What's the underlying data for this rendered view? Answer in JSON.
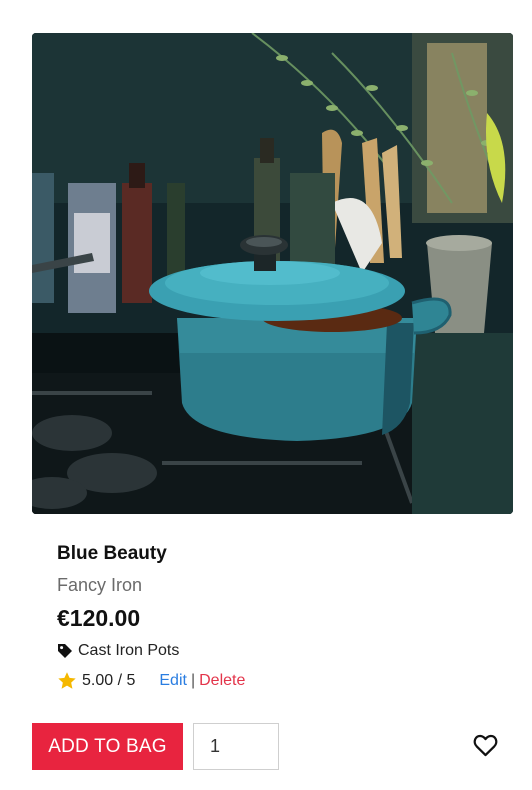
{
  "product": {
    "title": "Blue Beauty",
    "subtitle": "Fancy Iron",
    "price": "€120.00",
    "category": "Cast Iron Pots",
    "rating": "5.00 / 5",
    "image_alt": "teal-cast-iron-pot-on-stove"
  },
  "links": {
    "edit": "Edit",
    "separator": "|",
    "delete": "Delete"
  },
  "actions": {
    "add_to_bag": "ADD TO BAG",
    "quantity": "1"
  },
  "icons": {
    "tag": "tag-icon",
    "star": "star-icon",
    "wishlist": "heart-icon"
  },
  "colors": {
    "accent": "#e8243f",
    "link": "#2a7de1",
    "delete": "#e3344a",
    "star": "#f5b800"
  }
}
